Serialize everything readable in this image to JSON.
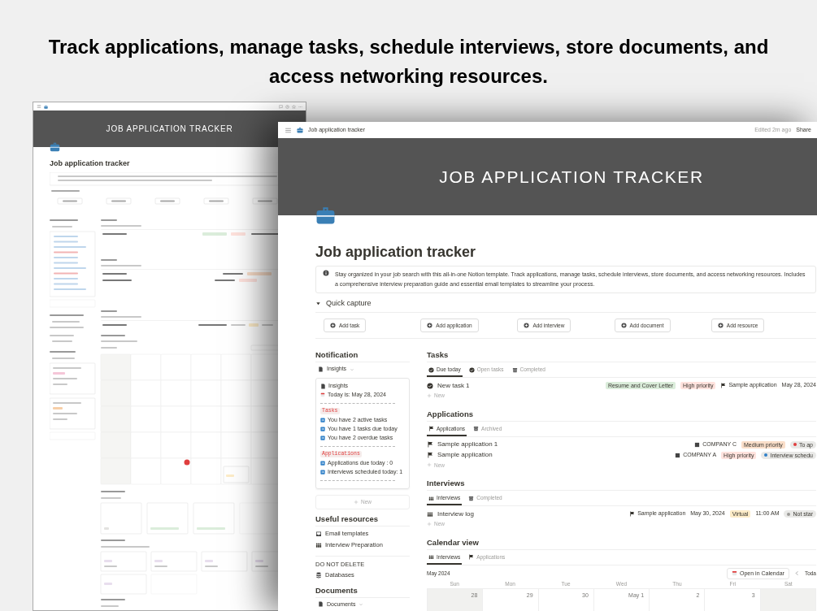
{
  "headline": "Track applications, manage tasks, schedule interviews, store documents, and access networking resources.",
  "windows": [
    {
      "banner": "JOB APPLICATION TRACKER",
      "title": "Job application tracker"
    },
    {
      "topbar": {
        "page_title": "Job application tracker",
        "edited": "Edited 2m ago",
        "share": "Share"
      },
      "banner": "JOB APPLICATION TRACKER",
      "title": "Job application tracker",
      "callout": "Stay organized in your job search with this all-in-one Notion template. Track applications, manage tasks, schedule interviews, store documents, and access networking resources. Includes a comprehensive interview preparation guide and essential email templates to streamline your process.",
      "quick_capture": {
        "label": "Quick capture",
        "expanded": true,
        "buttons": [
          "Add task",
          "Add application",
          "Add interview",
          "Add document",
          "Add resource"
        ]
      },
      "sidebar": [
        {
          "kind": "insights",
          "heading": "Notification",
          "view": "Insights",
          "card": [
            {
              "kind": "title",
              "text": "Insights"
            },
            {
              "kind": "date",
              "text": "Today is: May 28, 2024"
            },
            {
              "kind": "rule"
            },
            {
              "kind": "tag",
              "text": "Tasks"
            },
            {
              "kind": "item",
              "text": "You have 2 active tasks"
            },
            {
              "kind": "item",
              "text": "You have 1 tasks due today"
            },
            {
              "kind": "item",
              "text": "You have 2 overdue tasks"
            },
            {
              "kind": "rule"
            },
            {
              "kind": "tag",
              "text": "Applications"
            },
            {
              "kind": "item",
              "text": "Applications due today : 0"
            },
            {
              "kind": "item",
              "text": "Interviews scheduled today: 1"
            },
            {
              "kind": "rule"
            }
          ],
          "new": "New"
        },
        {
          "kind": "links",
          "heading": "Useful resources",
          "items": [
            {
              "kind": "mail",
              "text": "Email templates"
            },
            {
              "kind": "people",
              "text": "Interview Preparation"
            }
          ]
        },
        {
          "kind": "note",
          "heading": "DO NOT DELETE",
          "items": [
            {
              "kind": "database",
              "text": "Databases"
            }
          ]
        },
        {
          "kind": "documents",
          "heading": "Documents",
          "view": "Documents"
        }
      ],
      "main": [
        {
          "kind": "list",
          "heading": "Tasks",
          "tabs": [
            {
              "kind": "check",
              "label": "Due today",
              "selected": true
            },
            {
              "kind": "check",
              "label": "Open tasks",
              "selected": false
            },
            {
              "kind": "archive",
              "label": "Completed",
              "selected": false
            }
          ],
          "rows": [
            {
              "title": "New task 1",
              "props": [
                {
                  "kind": "tag",
                  "text": "Resume and Cover Letter",
                  "color": "#dbeddb"
                },
                {
                  "kind": "tag",
                  "text": "High priority",
                  "color": "#ffe2dd"
                },
                {
                  "kind": "application",
                  "text": "Sample application"
                },
                {
                  "kind": "text",
                  "text": "May 28, 2024"
                }
              ]
            }
          ],
          "new": "New"
        },
        {
          "kind": "list",
          "heading": "Applications",
          "tabs": [
            {
              "kind": "flag",
              "label": "Applications",
              "selected": true
            },
            {
              "kind": "archive",
              "label": "Archived",
              "selected": false
            }
          ],
          "rows": [
            {
              "title": "Sample application 1",
              "props": [
                {
                  "kind": "company",
                  "text": "COMPANY C"
                },
                {
                  "kind": "tag",
                  "text": "Medium priority",
                  "color": "#fadec9"
                },
                {
                  "kind": "status",
                  "text": "To ap",
                  "color": "#e03e3e"
                }
              ]
            },
            {
              "title": "Sample application",
              "props": [
                {
                  "kind": "company",
                  "text": "COMPANY A"
                },
                {
                  "kind": "tag",
                  "text": "High priority",
                  "color": "#ffe2dd"
                },
                {
                  "kind": "status",
                  "text": "Interview schedu",
                  "color": "#2f80c8"
                }
              ]
            }
          ],
          "new": "New"
        },
        {
          "kind": "list",
          "heading": "Interviews",
          "tabs": [
            {
              "kind": "people",
              "label": "Interviews",
              "selected": true
            },
            {
              "kind": "archive",
              "label": "Completed",
              "selected": false
            }
          ],
          "rows": [
            {
              "title": "Interview log",
              "props": [
                {
                  "kind": "application",
                  "text": "Sample application"
                },
                {
                  "kind": "text",
                  "text": "May 30, 2024"
                },
                {
                  "kind": "tag",
                  "text": "Virtual",
                  "color": "#fdecc8"
                },
                {
                  "kind": "text",
                  "text": "11:00 AM"
                },
                {
                  "kind": "status",
                  "text": "Not star",
                  "color": "#9b9a97"
                }
              ]
            }
          ],
          "new": "New"
        },
        {
          "kind": "calendar",
          "heading": "Calendar view",
          "tabs": [
            {
              "kind": "people",
              "label": "Interviews",
              "selected": true
            },
            {
              "kind": "flag",
              "label": "Applications",
              "selected": false
            }
          ],
          "month": "May 2024",
          "open_button": "Open in Calendar",
          "today_button": "Toda",
          "weekdays": [
            "Sun",
            "Mon",
            "Tue",
            "Wed",
            "Thu",
            "Fri",
            "Sat"
          ],
          "cells": [
            {
              "day": "28",
              "shaded": true,
              "today": false
            },
            {
              "day": "29",
              "shaded": false,
              "today": false
            },
            {
              "day": "30",
              "shaded": false,
              "today": false
            },
            {
              "day": "May 1",
              "shaded": false,
              "today": false
            },
            {
              "day": "2",
              "shaded": false,
              "today": false
            },
            {
              "day": "3",
              "shaded": false,
              "today": false
            }
          ]
        }
      ]
    }
  ]
}
